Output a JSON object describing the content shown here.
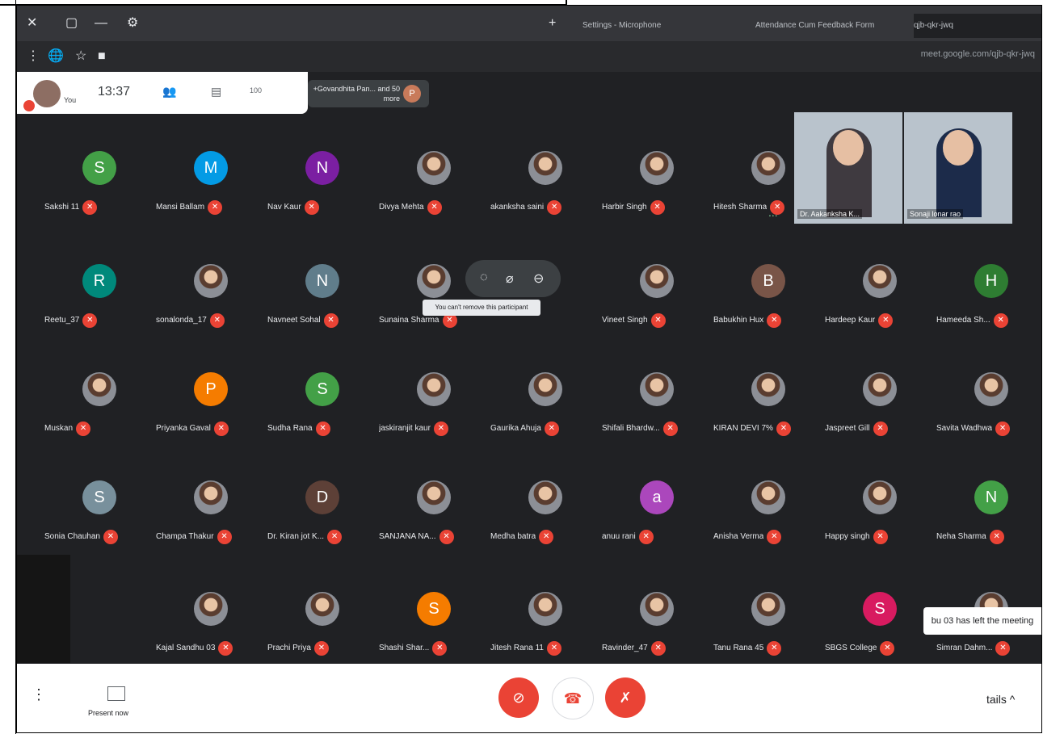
{
  "browser": {
    "tabs": [
      {
        "label": "Settings - Microphone"
      },
      {
        "label": "Attendance Cum Feedback Form"
      },
      {
        "label": "qjb-qkr-jwq"
      }
    ],
    "window_buttons": [
      "✕",
      "▢",
      "—",
      "⚙"
    ],
    "url": "meet.google.com/qjb-qkr-jwq",
    "address_icons": [
      "⋮",
      "🌐",
      "☆",
      "■",
      "🔒"
    ]
  },
  "meeting_hud": {
    "user_label": "You",
    "time": "13:37",
    "participant_count": "100",
    "raise_hand_icon": "hand-icon",
    "people_icon": "people-icon",
    "presenter_text": "+Govandhita Pan...\nand 50 more",
    "presenter_initial": "P"
  },
  "videos": [
    {
      "name": "Sonaji lonar rao"
    },
    {
      "name": "Dr. Aakanksha K..."
    }
  ],
  "more_label": "...",
  "hover_controls": {
    "labels": [
      "◌",
      "⌀",
      "⊖"
    ],
    "tooltip": "You can't remove this participant"
  },
  "toast": "bu 03 has left the meeting",
  "bottom": {
    "present_label": "Present now",
    "more_label": "tails ^",
    "hangup_icon": "phone-off-icon",
    "camera_icon": "camera-off-icon",
    "mic_icon": "mic-off-icon"
  },
  "participants": [
    {
      "name": "Hitesh Sharma",
      "initial": "",
      "color": "#3c4043",
      "row": 0,
      "col": 6
    },
    {
      "name": "Harbir Singh",
      "initial": "",
      "color": "#3c4043",
      "row": 0,
      "col": 5
    },
    {
      "name": "akanksha saini",
      "initial": "",
      "color": "#3c4043",
      "row": 0,
      "col": 4
    },
    {
      "name": "Divya Mehta",
      "initial": "",
      "color": "#3c4043",
      "row": 0,
      "col": 3
    },
    {
      "name": "Nav Kaur",
      "initial": "N",
      "color": "#7b1fa2",
      "row": 0,
      "col": 2
    },
    {
      "name": "Mansi Ballam",
      "initial": "M",
      "color": "#039be5",
      "row": 0,
      "col": 1
    },
    {
      "name": "Sakshi 11",
      "initial": "S",
      "color": "#43a047",
      "row": 0,
      "col": 0
    },
    {
      "name": "Hameeda Sh...",
      "initial": "H",
      "color": "#2e7d32",
      "row": 1,
      "col": 8
    },
    {
      "name": "Hardeep Kaur",
      "initial": "",
      "color": "#6d4c41",
      "row": 1,
      "col": 7
    },
    {
      "name": "Babukhin Hux",
      "initial": "B",
      "color": "#795548",
      "row": 1,
      "col": 6
    },
    {
      "name": "Vineet Singh",
      "initial": "",
      "color": "#3c4043",
      "row": 1,
      "col": 5
    },
    {
      "name": "Sunaina Sharma",
      "initial": "",
      "color": "#3c4043",
      "row": 1,
      "col": 3
    },
    {
      "name": "Navneet Sohal",
      "initial": "N",
      "color": "#607d8b",
      "row": 1,
      "col": 2
    },
    {
      "name": "sonalonda_17",
      "initial": "",
      "color": "#3c4043",
      "row": 1,
      "col": 1
    },
    {
      "name": "Reetu_37",
      "initial": "R",
      "color": "#00897b",
      "row": 1,
      "col": 0
    },
    {
      "name": "Savita Wadhwa",
      "initial": "",
      "color": "#3c4043",
      "row": 2,
      "col": 8
    },
    {
      "name": "Jaspreet Gill",
      "initial": "",
      "color": "#3c4043",
      "row": 2,
      "col": 7
    },
    {
      "name": "KIRAN DEVI 7%",
      "initial": "",
      "color": "#3c4043",
      "row": 2,
      "col": 6
    },
    {
      "name": "Shifali Bhardw...",
      "initial": "",
      "color": "#3c4043",
      "row": 2,
      "col": 5
    },
    {
      "name": "Gaurika Ahuja",
      "initial": "",
      "color": "#3c4043",
      "row": 2,
      "col": 4
    },
    {
      "name": "jaskiranjit kaur",
      "initial": "",
      "color": "#3c4043",
      "row": 2,
      "col": 3
    },
    {
      "name": "Sudha Rana",
      "initial": "S",
      "color": "#43a047",
      "row": 2,
      "col": 2
    },
    {
      "name": "Priyanka Gaval",
      "initial": "P",
      "color": "#f57c00",
      "row": 2,
      "col": 1
    },
    {
      "name": "Muskan",
      "initial": "",
      "color": "#3c4043",
      "row": 2,
      "col": 0
    },
    {
      "name": "Neha Sharma",
      "initial": "N",
      "color": "#43a047",
      "row": 3,
      "col": 8
    },
    {
      "name": "Happy singh",
      "initial": "",
      "color": "#3c4043",
      "row": 3,
      "col": 7
    },
    {
      "name": "Anisha Verma",
      "initial": "",
      "color": "#3c4043",
      "row": 3,
      "col": 6
    },
    {
      "name": "anuu rani",
      "initial": "a",
      "color": "#ab47bc",
      "row": 3,
      "col": 5
    },
    {
      "name": "Medha batra",
      "initial": "",
      "color": "#3c4043",
      "row": 3,
      "col": 4
    },
    {
      "name": "SANJANA NA...",
      "initial": "",
      "color": "#3c4043",
      "row": 3,
      "col": 3
    },
    {
      "name": "Dr. Kiran jot K...",
      "initial": "D",
      "color": "#5d4037",
      "row": 3,
      "col": 2
    },
    {
      "name": "Champa Thakur",
      "initial": "",
      "color": "#3c4043",
      "row": 3,
      "col": 1
    },
    {
      "name": "Sonia Chauhan",
      "initial": "S",
      "color": "#78909c",
      "row": 3,
      "col": 0
    },
    {
      "name": "Simran Dahm...",
      "initial": "",
      "color": "#3c4043",
      "row": 4,
      "col": 8
    },
    {
      "name": "SBGS College",
      "initial": "S",
      "color": "#d81b60",
      "row": 4,
      "col": 7
    },
    {
      "name": "Tanu Rana 45",
      "initial": "",
      "color": "#3c4043",
      "row": 4,
      "col": 6
    },
    {
      "name": "Ravinder_47",
      "initial": "",
      "color": "#3c4043",
      "row": 4,
      "col": 5
    },
    {
      "name": "Jitesh Rana 11",
      "initial": "",
      "color": "#3c4043",
      "row": 4,
      "col": 4
    },
    {
      "name": "Shashi Shar...",
      "initial": "S",
      "color": "#f57c00",
      "row": 4,
      "col": 3
    },
    {
      "name": "Prachi Priya",
      "initial": "",
      "color": "#3c4043",
      "row": 4,
      "col": 2
    },
    {
      "name": "Kajal Sandhu 03",
      "initial": "",
      "color": "#3c4043",
      "row": 4,
      "col": 1
    }
  ]
}
